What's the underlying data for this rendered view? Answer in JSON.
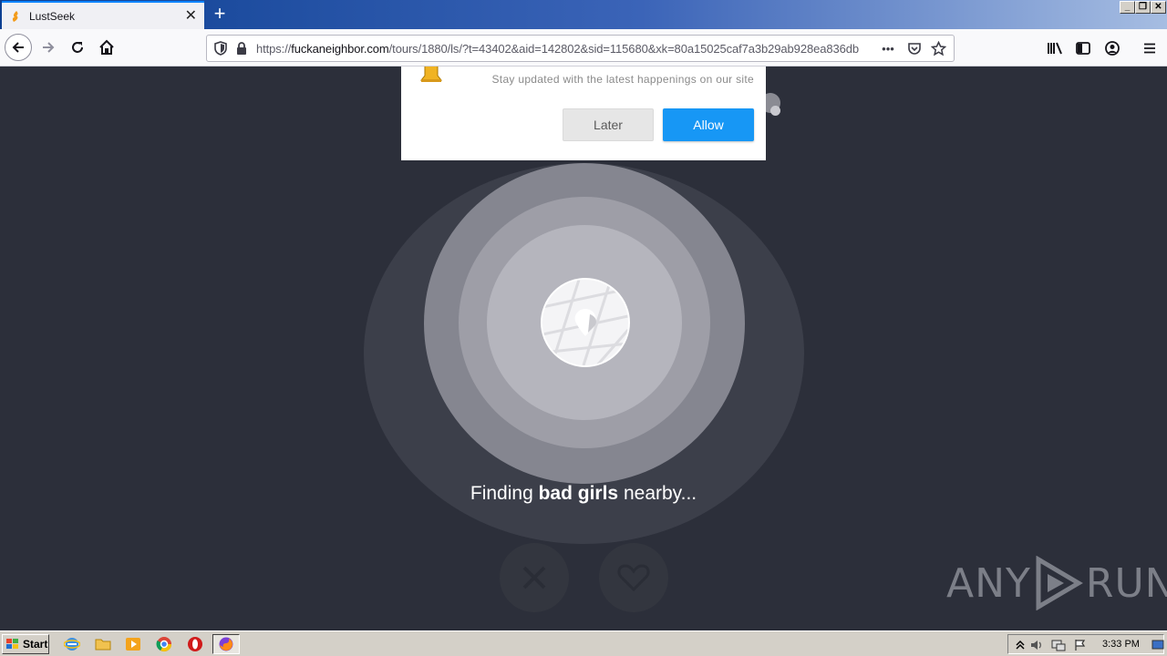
{
  "browser": {
    "tab_title": "LustSeek",
    "new_tab_label": "+",
    "url_prefix": "https://",
    "url_host": "fuckaneighbor.com",
    "url_path": "/tours/1880/ls/?t=43402&aid=142802&sid=115680&xk=80a15025caf7a3b29ab928ea836db",
    "more_label": "•••"
  },
  "notification": {
    "message": "Stay updated with the latest happenings on our site",
    "later_label": "Later",
    "allow_label": "Allow"
  },
  "page": {
    "finding_prefix": "Finding ",
    "finding_bold": "bad girls",
    "finding_suffix": " nearby..."
  },
  "watermark": {
    "text_left": "ANY",
    "text_right": "RUN"
  },
  "taskbar": {
    "start_label": "Start",
    "clock": "3:33 PM"
  },
  "colors": {
    "page_background": "#2c2f3a",
    "allow_button": "#1797f5",
    "later_button": "#e6e6e6"
  }
}
